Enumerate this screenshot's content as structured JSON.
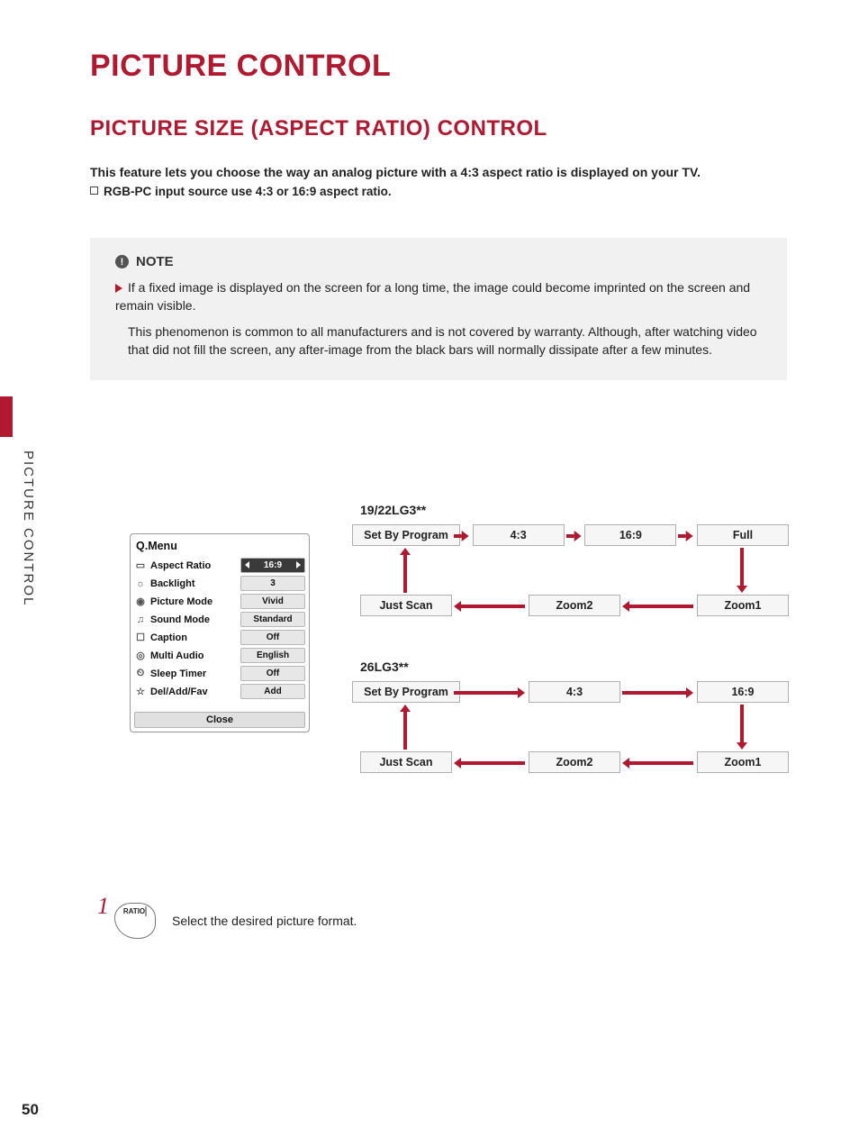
{
  "side_label": "PICTURE CONTROL",
  "title": "PICTURE CONTROL",
  "subtitle": "PICTURE SIZE (ASPECT RATIO) CONTROL",
  "intro": "This feature lets you choose the way an analog picture with a 4:3 aspect ratio is displayed on your TV.",
  "intro2": "RGB-PC input source use 4:3 or 16:9 aspect ratio.",
  "note": {
    "heading": "NOTE",
    "body1": "If a fixed image is displayed on the screen for a long time, the image could become imprinted on the screen and remain visible.",
    "body2": "This phenomenon is common to all manufacturers and is not covered by warranty. Although, after watching video that did not fill the screen, any after-image from the black bars will normally dissipate after a few minutes."
  },
  "qmenu": {
    "title": "Q.Menu",
    "rows": [
      {
        "icon": "rect-icon",
        "label": "Aspect Ratio",
        "value": "16:9",
        "active": true
      },
      {
        "icon": "sun-icon",
        "label": "Backlight",
        "value": "3"
      },
      {
        "icon": "eye-icon",
        "label": "Picture Mode",
        "value": "Vivid"
      },
      {
        "icon": "note-icon",
        "label": "Sound Mode",
        "value": "Standard"
      },
      {
        "icon": "caption-icon",
        "label": "Caption",
        "value": "Off"
      },
      {
        "icon": "audio-icon",
        "label": "Multi Audio",
        "value": "English"
      },
      {
        "icon": "clock-icon",
        "label": "Sleep Timer",
        "value": "Off"
      },
      {
        "icon": "fav-icon",
        "label": "Del/Add/Fav",
        "value": "Add"
      }
    ],
    "close": "Close"
  },
  "flows": [
    {
      "model": "19/22LG3**",
      "top": [
        "Set By Program",
        "4:3",
        "16:9",
        "Full"
      ],
      "bottom": [
        "Just Scan",
        "Zoom2",
        "Zoom1"
      ]
    },
    {
      "model": "26LG3**",
      "top": [
        "Set By Program",
        "4:3",
        "16:9"
      ],
      "bottom": [
        "Just Scan",
        "Zoom2",
        "Zoom1"
      ]
    }
  ],
  "step": {
    "number": "1",
    "button_label": "RATIO",
    "text": "Select the desired picture format."
  },
  "page_number": "50"
}
